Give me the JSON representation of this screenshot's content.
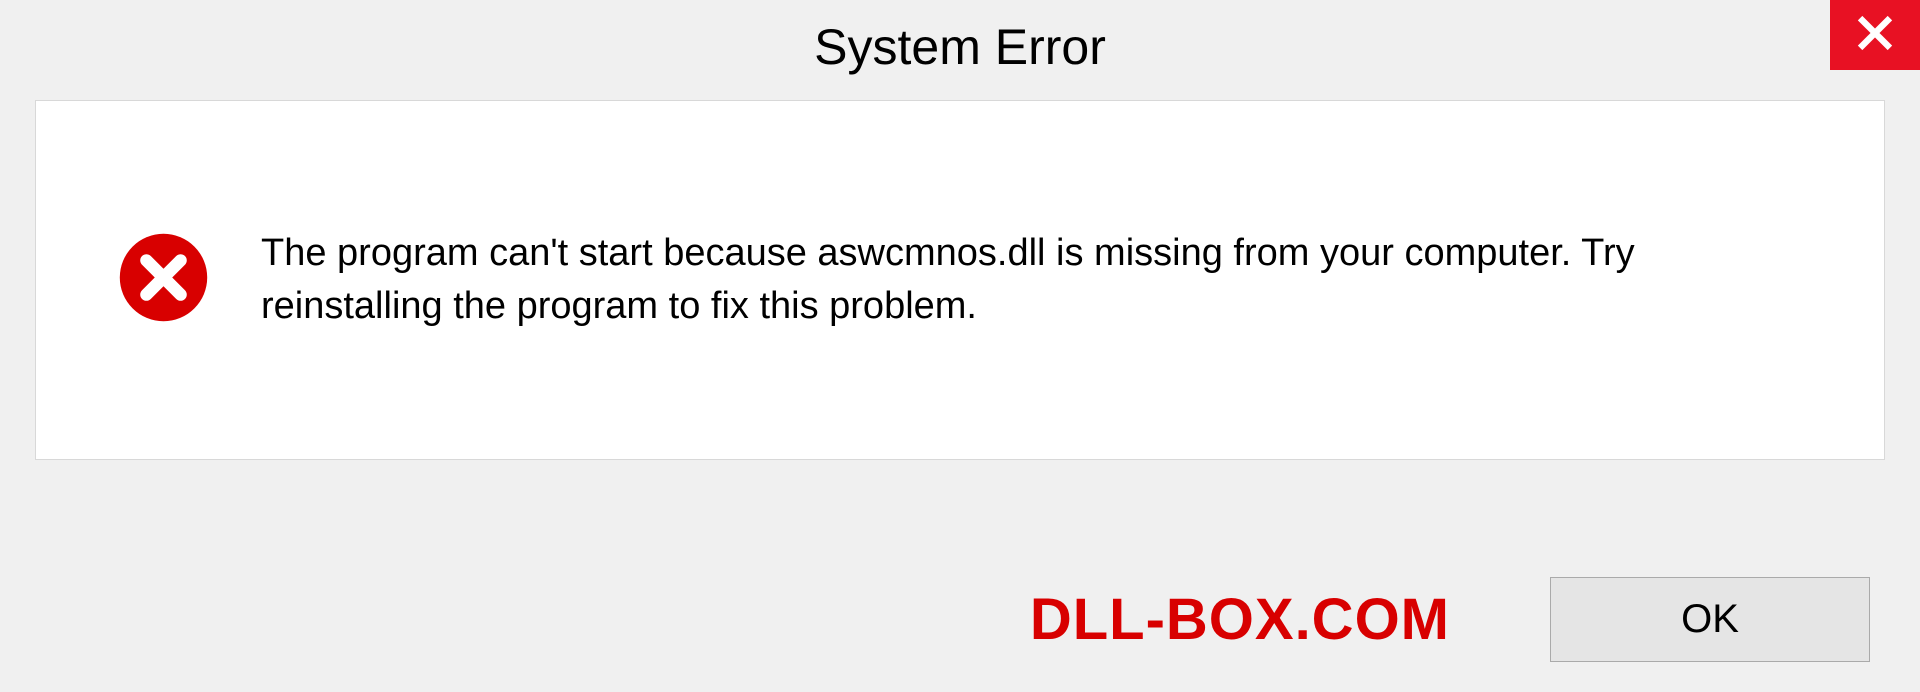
{
  "titlebar": {
    "title": "System Error"
  },
  "message": {
    "text": "The program can't start because aswcmnos.dll is missing from your computer. Try reinstalling the program to fix this problem."
  },
  "footer": {
    "brand": "DLL-BOX.COM",
    "ok_label": "OK"
  },
  "colors": {
    "close_bg": "#e81123",
    "error_icon": "#d80000",
    "brand": "#d80000"
  }
}
